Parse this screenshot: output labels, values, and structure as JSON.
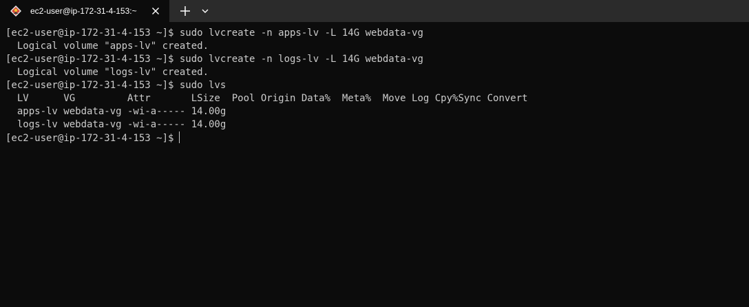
{
  "tab": {
    "title": "ec2-user@ip-172-31-4-153:~",
    "icon": "linux-tux-icon"
  },
  "terminal": {
    "lines": [
      "[ec2-user@ip-172-31-4-153 ~]$ sudo lvcreate -n apps-lv -L 14G webdata-vg",
      "  Logical volume \"apps-lv\" created.",
      "[ec2-user@ip-172-31-4-153 ~]$ sudo lvcreate -n logs-lv -L 14G webdata-vg",
      "  Logical volume \"logs-lv\" created.",
      "[ec2-user@ip-172-31-4-153 ~]$ sudo lvs",
      "  LV      VG         Attr       LSize  Pool Origin Data%  Meta%  Move Log Cpy%Sync Convert",
      "  apps-lv webdata-vg -wi-a----- 14.00g",
      "  logs-lv webdata-vg -wi-a----- 14.00g"
    ],
    "prompt": "[ec2-user@ip-172-31-4-153 ~]$"
  },
  "colors": {
    "background": "#0c0c0c",
    "tabbar": "#2b2b2b",
    "text": "#cccccc"
  }
}
